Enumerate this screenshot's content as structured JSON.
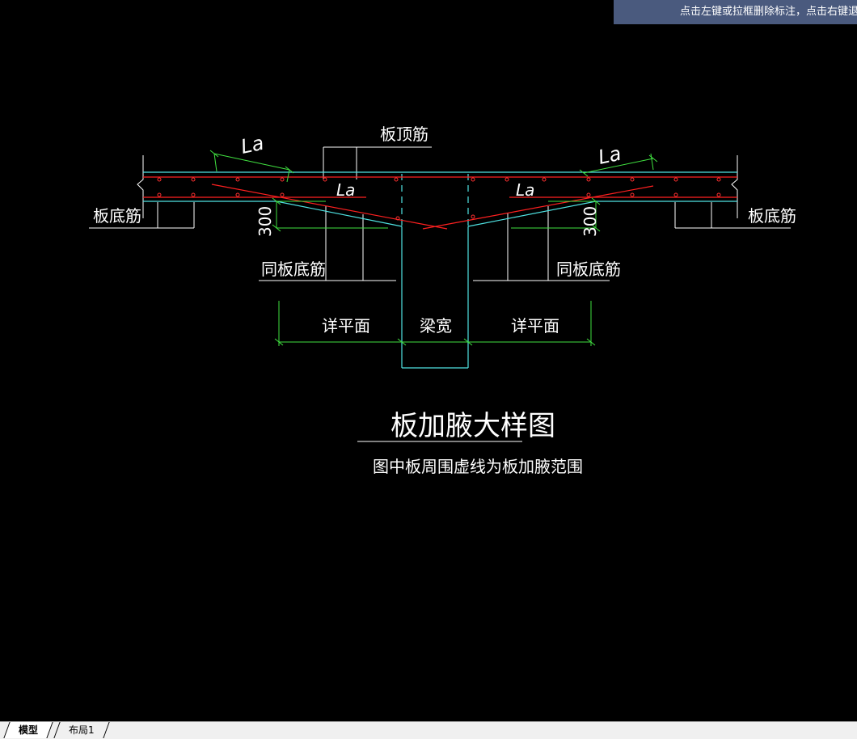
{
  "status_hint": "点击左键或拉框删除标注，点击右键退出",
  "drawing": {
    "label_top_bar": "板顶筋",
    "label_bottom_bar_left": "板底筋",
    "label_bottom_bar_right": "板底筋",
    "label_same_bottom_left": "同板底筋",
    "label_same_bottom_right": "同板底筋",
    "label_la_top_left": "La",
    "label_la_top_right": "La",
    "label_la_inner_left": "La",
    "label_la_inner_right": "La",
    "label_dim_left": "300",
    "label_dim_right": "300",
    "label_detail_left": "详平面",
    "label_beam_width": "梁宽",
    "label_detail_right": "详平面",
    "title": "板加腋大样图",
    "note": "图中板周围虚线为板加腋范围"
  },
  "tabs": [
    {
      "label": "模型"
    },
    {
      "label": "布局1"
    }
  ]
}
